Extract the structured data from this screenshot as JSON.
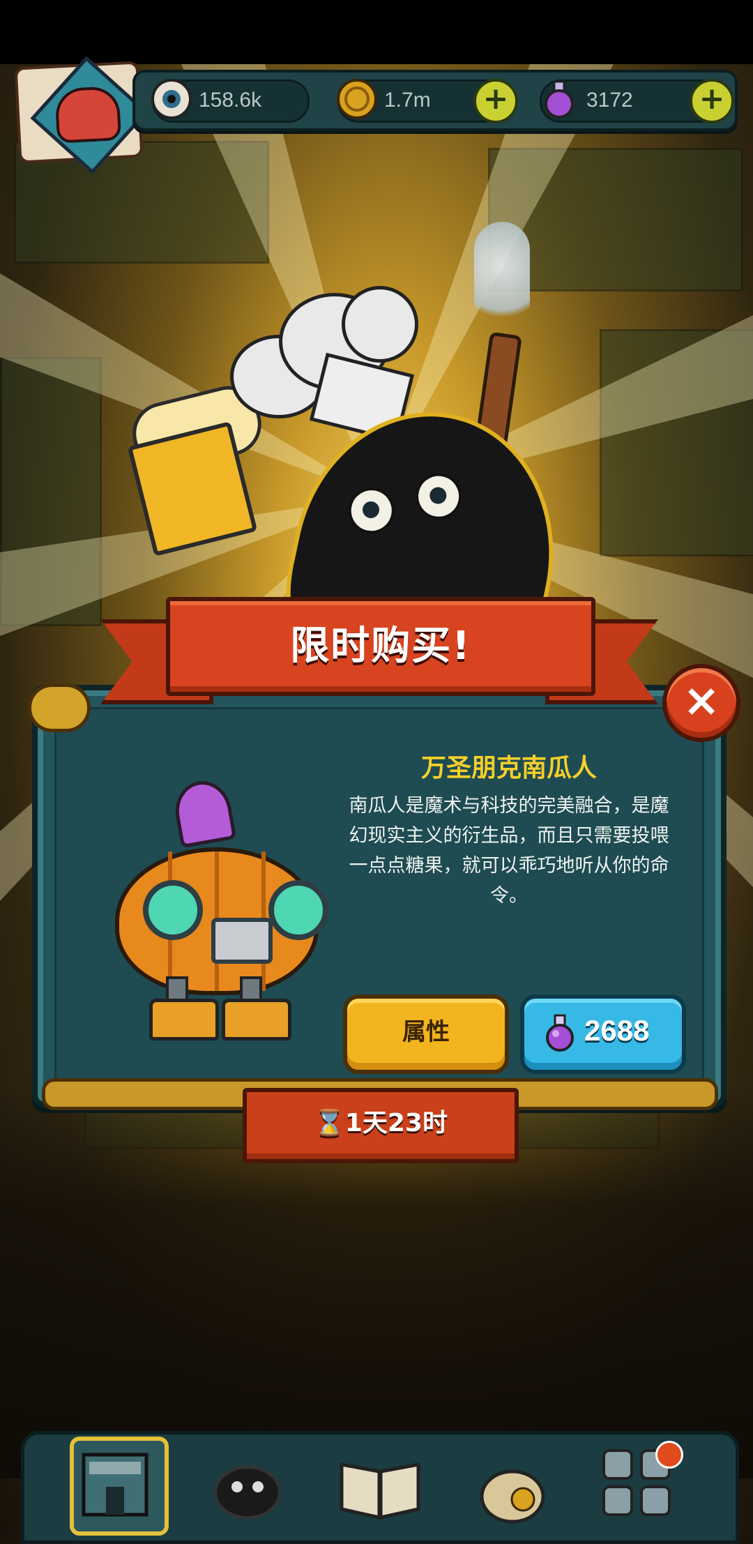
{
  "resources": {
    "eyes": "158.6k",
    "coins": "1.7m",
    "potions": "3172"
  },
  "offer": {
    "banner_title": "限时购买!",
    "item_name": "万圣朋克南瓜人",
    "item_description": "南瓜人是魔术与科技的完美融合，是魔幻现实主义的衍生品，而且只需要投喂一点点糖果，就可以乖巧地听从你的命令。",
    "attributes_button": "属性",
    "price": "2688",
    "timer": "1天23时"
  },
  "icons": {
    "close": "×",
    "plus": "+",
    "hourglass": "⌛"
  },
  "colors": {
    "panel": "#22555c",
    "ribbon": "#d84420",
    "gold_text": "#f5d02a",
    "attr_button": "#f3b51f",
    "buy_button": "#37b9e6"
  }
}
